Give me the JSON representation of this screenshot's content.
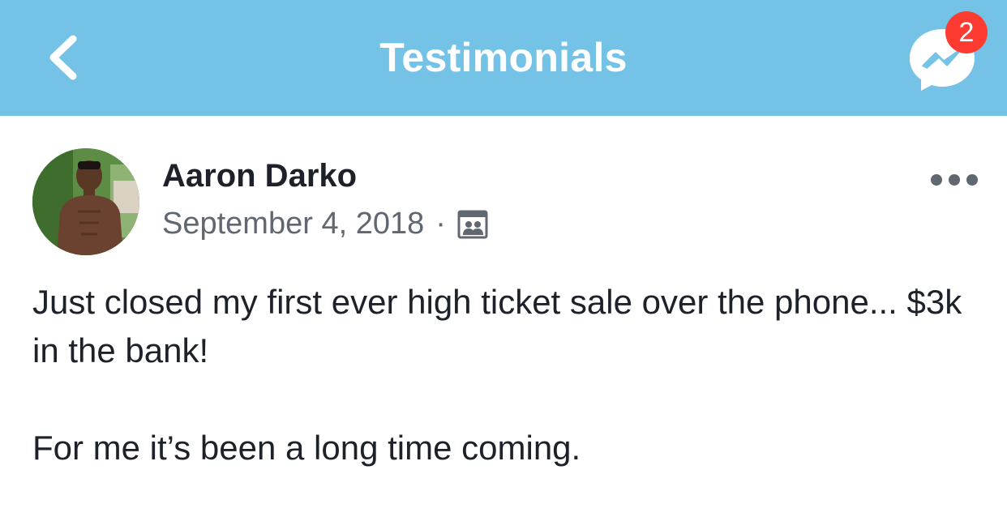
{
  "header": {
    "title": "Testimonials",
    "back_icon": "chevron-left-icon",
    "messenger_icon": "messenger-icon",
    "badge_count": "2",
    "background_color": "#74c3e7",
    "badge_color": "#fe3b30"
  },
  "post": {
    "author": "Aaron Darko",
    "date": "September 4, 2018",
    "separator": "·",
    "audience_icon": "group-audience-icon",
    "more_icon": "more-options-icon",
    "paragraphs": [
      "Just closed my first ever high ticket sale over the phone... $3k in the bank!",
      "For me it’s been a long time coming."
    ]
  }
}
